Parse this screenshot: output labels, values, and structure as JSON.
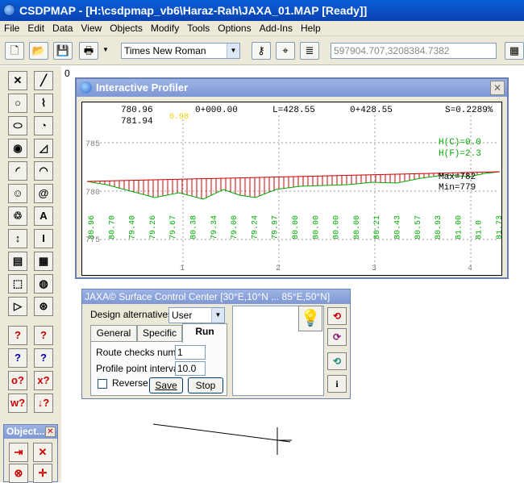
{
  "window": {
    "title": "CSDPMAP - [H:\\csdpmap_vb6\\Haraz-Rah\\JAXA_01.MAP [Ready]]"
  },
  "menu": [
    "File",
    "Edit",
    "Data",
    "View",
    "Objects",
    "Modify",
    "Tools",
    "Options",
    "Add-Ins",
    "Help"
  ],
  "toolbar": {
    "font": "Times New Roman",
    "coords": "597904.707,3208384.7382"
  },
  "canvas": {
    "ruler_label": "0"
  },
  "profiler": {
    "title": "Interactive Profiler",
    "header": {
      "left1": "780.96",
      "left2": "781.94",
      "yellow": "0.98",
      "station_start": "0+000.00",
      "length": "L=428.55",
      "station_end": "0+428.55",
      "slope": "S=0.2289%"
    },
    "hc": "H(C)=0.0",
    "hf": "H(F)=2.3",
    "max": "Max=782",
    "min": "Min=779",
    "y_labels": [
      "785",
      "780",
      "775"
    ],
    "x_labels": [
      "1",
      "2",
      "3",
      "4"
    ],
    "values": [
      "80.96",
      "80.70",
      "79.40",
      "79.26",
      "79.67",
      "80.38",
      "79.34",
      "79.00",
      "79.24",
      "79.97",
      "80.00",
      "80.00",
      "80.00",
      "80.00",
      "80.21",
      "80.43",
      "80.57",
      "80.93",
      "81.00",
      "81.0",
      "81.73"
    ]
  },
  "jaxa": {
    "title": "JAXA© Surface Control Center [30°E,10°N ... 85°E,50°N]",
    "design_label": "Design alternatives:",
    "design_value": "User",
    "tabs": [
      "General",
      "Specific",
      "Run"
    ],
    "route_label": "Route checks num:",
    "route_value": "1",
    "interval_label": "Profile point interval:",
    "interval_value": "10.0",
    "reverse_label": "Reverse",
    "save_label": "Save",
    "stop_label": "Stop",
    "info_label": "i"
  },
  "objects": {
    "title": "Object..."
  },
  "colors": {
    "accent_title": "#0842b0",
    "plot_green": "#00aa00",
    "plot_red": "#cc0000"
  }
}
